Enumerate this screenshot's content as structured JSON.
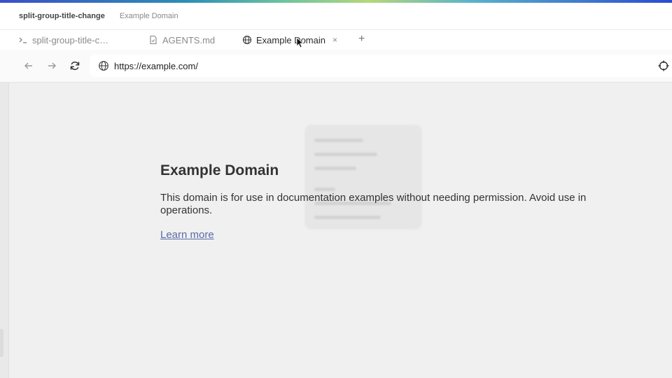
{
  "window": {
    "group_title": "split-group-title-change",
    "page_title": "Example Domain"
  },
  "tabs": [
    {
      "label": "split-group-title-c…",
      "icon": "terminal-icon",
      "active": false
    },
    {
      "label": "AGENTS.md",
      "icon": "file-icon",
      "active": false
    },
    {
      "label": "Example Domain",
      "icon": "globe-icon",
      "active": true,
      "close": "×"
    }
  ],
  "new_tab_label": "+",
  "toolbar": {
    "back_icon": "arrow-left-icon",
    "forward_icon": "arrow-right-icon",
    "reload_icon": "reload-icon",
    "url": "https://example.com/"
  },
  "page": {
    "heading": "Example Domain",
    "paragraph": "This domain is for use in documentation examples without needing permission. Avoid use in operations.",
    "link": "Learn more"
  },
  "colors": {
    "accent_gradient": [
      "#3b4fc9",
      "#2d8fb5",
      "#6cc3a0",
      "#b6d77a",
      "#2a4bd0"
    ],
    "link": "#5a6aa8"
  }
}
